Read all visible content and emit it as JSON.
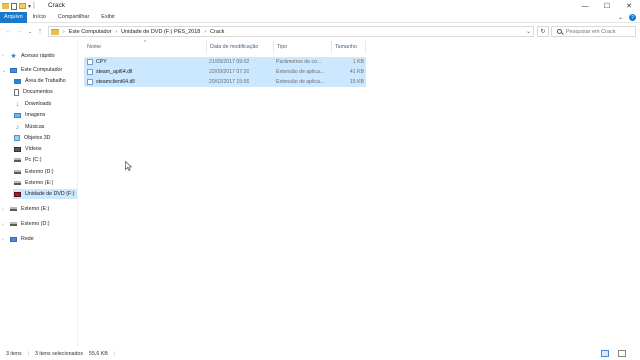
{
  "window": {
    "title": "Crack",
    "controls": {
      "minimize": "—",
      "maximize": "☐",
      "close": "✕"
    }
  },
  "ribbon": {
    "tabs": [
      "Arquivo",
      "Início",
      "Compartilhar",
      "Exibir"
    ],
    "expand": "⌄",
    "help": "?"
  },
  "nav": {
    "back": "←",
    "forward": "→",
    "recent": "⌄",
    "up": "↑"
  },
  "address": {
    "crumbs": [
      "Este Computador",
      "Unidade de DVD (F:) PES_2018",
      "Crack"
    ],
    "separator": "›",
    "refresh": "↻"
  },
  "search": {
    "placeholder": "Pesquisar em Crack"
  },
  "sidebar": {
    "items": [
      {
        "label": "Acesso rápido",
        "icon": "star-icon"
      },
      {
        "label": "Este Computador",
        "icon": "computer-icon"
      },
      {
        "label": "Área de Trabalho",
        "icon": "desktop-icon"
      },
      {
        "label": "Documentos",
        "icon": "documents-icon"
      },
      {
        "label": "Downloads",
        "icon": "downloads-icon"
      },
      {
        "label": "Imagens",
        "icon": "pictures-icon"
      },
      {
        "label": "Músicas",
        "icon": "music-icon"
      },
      {
        "label": "Objetos 3D",
        "icon": "3d-objects-icon"
      },
      {
        "label": "Vídeos",
        "icon": "videos-icon"
      },
      {
        "label": "Pc (C:)",
        "icon": "drive-icon"
      },
      {
        "label": "Externo (D:)",
        "icon": "drive-icon"
      },
      {
        "label": "Externo (E:)",
        "icon": "drive-icon"
      },
      {
        "label": "Unidade de DVD (F:)",
        "icon": "dvd-icon"
      },
      {
        "label": "Externo (E:)",
        "icon": "drive-icon"
      },
      {
        "label": "Externo (D:)",
        "icon": "drive-icon"
      },
      {
        "label": "Rede",
        "icon": "network-icon"
      }
    ]
  },
  "columns": {
    "name": "Nome",
    "date": "Data de modificação",
    "type": "Tipo",
    "size": "Tamanho"
  },
  "files": [
    {
      "name": "CPY",
      "date": "21/09/2017 09:02",
      "type": "Parâmetros de co...",
      "size": "1 KB"
    },
    {
      "name": "steam_api64.dll",
      "date": "22/09/2017 07:20",
      "type": "Extensão de aplica...",
      "size": "41 KB"
    },
    {
      "name": "steamclient64.dll",
      "date": "20/02/2017 15:56",
      "type": "Extensão de aplica...",
      "size": "15 KB"
    }
  ],
  "status": {
    "count": "3 itens",
    "selected": "3 itens selecionados",
    "size": "55,6 KB"
  }
}
